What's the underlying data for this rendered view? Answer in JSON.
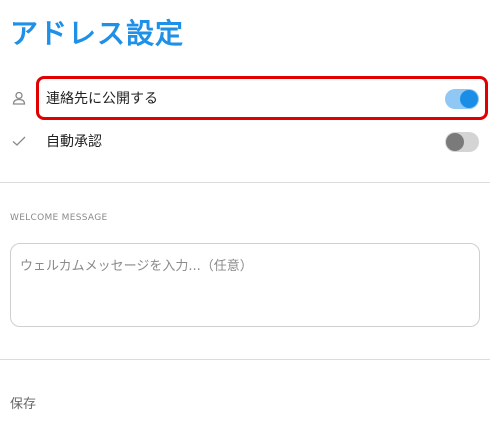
{
  "header": {
    "title": "アドレス設定"
  },
  "settings": {
    "items": [
      {
        "icon": "person-icon",
        "label": "連絡先に公開する",
        "enabled": true
      },
      {
        "icon": "check-icon",
        "label": "自動承認",
        "enabled": false
      }
    ]
  },
  "welcome": {
    "section_label": "WELCOME MESSAGE",
    "placeholder": "ウェルカムメッセージを入力...（任意）"
  },
  "actions": {
    "save_label": "保存"
  },
  "colors": {
    "accent": "#1e90e8",
    "highlight": "#e00000",
    "toggle_on": "#1a8ee6",
    "toggle_off": "#7a7a7a"
  }
}
